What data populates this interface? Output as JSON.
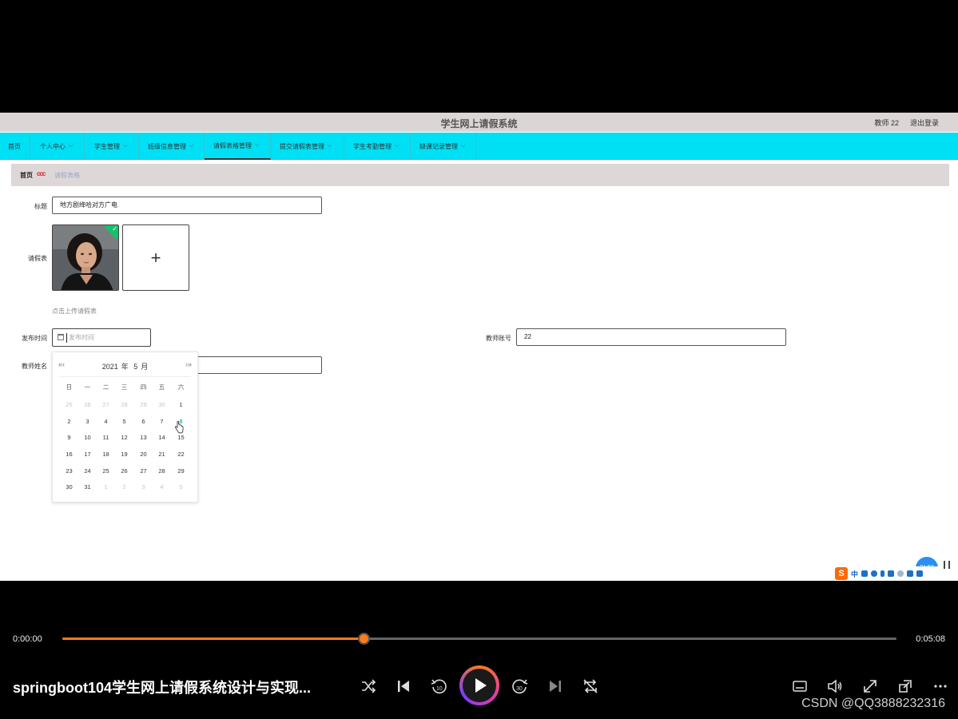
{
  "app": {
    "system_title": "学生网上请假系统",
    "user_label": "教师 22",
    "logout_label": "退出登录"
  },
  "nav": {
    "items": [
      {
        "label": "首页"
      },
      {
        "label": "个人中心"
      },
      {
        "label": "学生管理"
      },
      {
        "label": "班级信息管理"
      },
      {
        "label": "请假表格管理"
      },
      {
        "label": "提交请假表管理"
      },
      {
        "label": "学生考勤管理"
      },
      {
        "label": "缺课记录管理"
      }
    ]
  },
  "breadcrumb": {
    "home": "首页",
    "separator": "ccc",
    "current": "请假表格"
  },
  "form": {
    "title_label": "标题",
    "title_value": "地方剧绛哈对方广电",
    "leave_form_label": "请假表",
    "upload_tip": "点击上传请假表",
    "publish_time_label": "发布时间",
    "publish_time_placeholder": "发布时间",
    "teacher_account_label": "教师账号",
    "teacher_account_value": "22",
    "teacher_name_label": "教师姓名"
  },
  "calendar": {
    "prev_label": "«‹",
    "next_label": "›»",
    "year": "2021",
    "year_unit": "年",
    "month": "5",
    "month_unit": "月",
    "weekdays": [
      "日",
      "一",
      "二",
      "三",
      "四",
      "五",
      "六"
    ],
    "weeks": [
      [
        "25",
        "26",
        "27",
        "28",
        "29",
        "30",
        "1"
      ],
      [
        "2",
        "3",
        "4",
        "5",
        "6",
        "7",
        "8"
      ],
      [
        "9",
        "10",
        "11",
        "12",
        "13",
        "14",
        "15"
      ],
      [
        "16",
        "17",
        "18",
        "19",
        "20",
        "21",
        "22"
      ],
      [
        "23",
        "24",
        "25",
        "26",
        "27",
        "28",
        "29"
      ],
      [
        "30",
        "31",
        "1",
        "2",
        "3",
        "4",
        "5"
      ]
    ],
    "today": "8"
  },
  "overlay": {
    "ime_logo": "S",
    "ime_mode": "中",
    "timer_text": "01:50"
  },
  "player": {
    "current_time": "0:00:00",
    "total_time": "0:05:08",
    "progress": 0.361,
    "video_title": "springboot104学生网上请假系统设计与实现...",
    "watermark": "CSDN @QQ3888232316",
    "accent_color": "#ff7a1a"
  }
}
